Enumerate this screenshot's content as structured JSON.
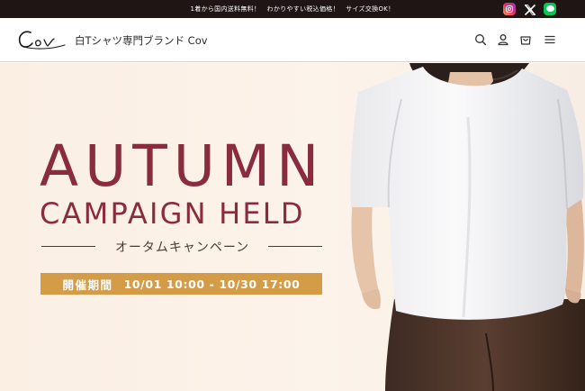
{
  "announcement": {
    "text": "1着から国内送料無料！　わかりやすい税込価格！　サイズ交換OK！"
  },
  "social": {
    "icons": [
      "instagram-icon",
      "x-icon",
      "line-icon"
    ],
    "colors": {
      "instagram": "#e1306c",
      "x": "#ffffff",
      "line": "#06c755"
    }
  },
  "header": {
    "logo_text": "Cov",
    "brand_name": "白Tシャツ専門ブランド Cov",
    "icons": [
      "search-icon",
      "account-icon",
      "cart-icon",
      "menu-icon"
    ]
  },
  "hero": {
    "title_line1": "AUTUMN",
    "title_line2": "CAMPAIGN HELD",
    "subtitle": "オータムキャンペーン",
    "period_label": "開催期間",
    "period_dates": "10/01 10:00 - 10/30 17:00",
    "colors": {
      "title": "#8a2c40",
      "background": "#fbefe4",
      "period_band": "#d59c48",
      "topbar": "#1e1514"
    }
  }
}
